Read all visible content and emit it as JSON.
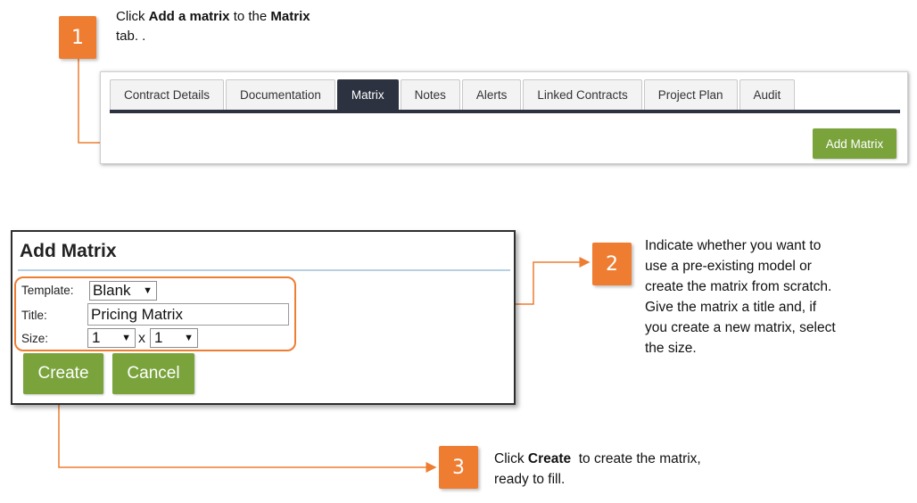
{
  "step1": {
    "number": "1",
    "text_prefix": "Click ",
    "text_bold1": "Add a matrix",
    "text_mid": " to the ",
    "text_bold2": "Matrix",
    "text_suffix": "tab. ."
  },
  "tabs": [
    {
      "label": "Contract Details",
      "active": false
    },
    {
      "label": "Documentation",
      "active": false
    },
    {
      "label": "Matrix",
      "active": true
    },
    {
      "label": "Notes",
      "active": false
    },
    {
      "label": "Alerts",
      "active": false
    },
    {
      "label": "Linked Contracts",
      "active": false
    },
    {
      "label": "Project Plan",
      "active": false
    },
    {
      "label": "Audit",
      "active": false
    }
  ],
  "add_matrix_button": "Add Matrix",
  "dialog": {
    "title": "Add Matrix",
    "template_label": "Template:",
    "template_value": "Blank",
    "title_label": "Title:",
    "title_value": "Pricing Matrix",
    "size_label": "Size:",
    "size_rows": "1",
    "size_sep": "x",
    "size_cols": "1",
    "create_label": "Create",
    "cancel_label": "Cancel"
  },
  "step2": {
    "number": "2",
    "lines": [
      "Indicate whether you want to",
      "use a pre-existing model or",
      "create the matrix from scratch.",
      "Give the matrix a title and, if",
      "you create a new matrix, select",
      "the size."
    ]
  },
  "step3": {
    "number": "3",
    "text_prefix": "Click ",
    "text_bold": "Create",
    "text_suffix": "  to create the matrix,",
    "text_line2": "ready to fill."
  },
  "colors": {
    "accent_orange": "#ee7d31",
    "button_green": "#7aa33c",
    "tab_active": "#2c3240"
  }
}
